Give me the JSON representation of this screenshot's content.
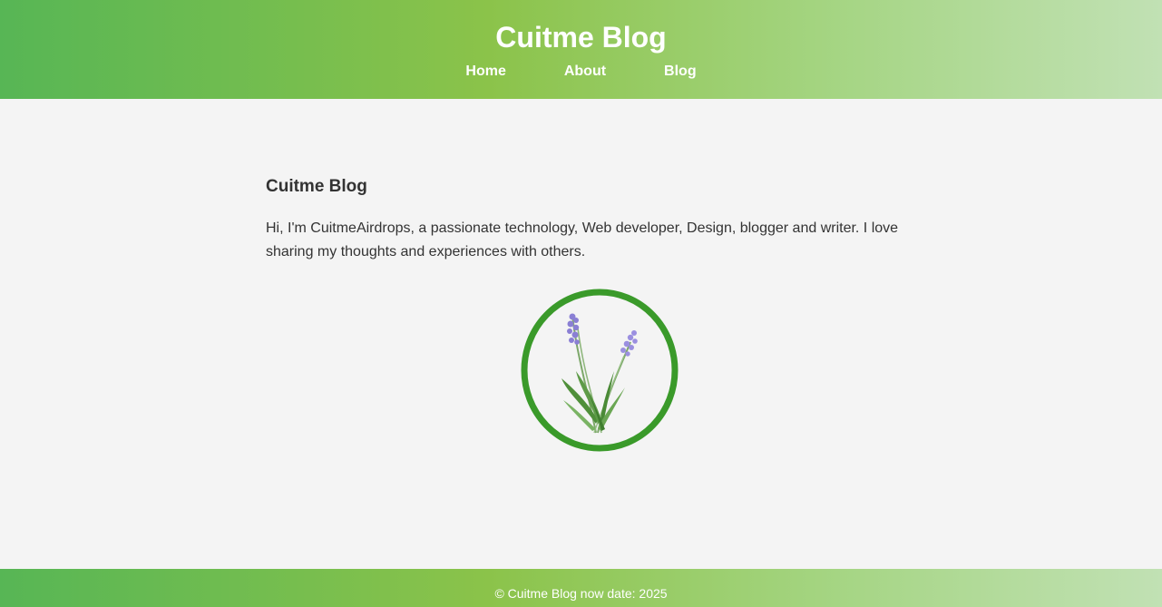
{
  "header": {
    "title": "Cuitme Blog",
    "nav": [
      {
        "label": "Home"
      },
      {
        "label": "About"
      },
      {
        "label": "Blog"
      }
    ]
  },
  "main": {
    "heading": "Cuitme Blog",
    "paragraph": "Hi, I'm CuitmeAirdrops, a passionate technology, Web developer, Design, blogger and writer. I love sharing my thoughts and experiences with others.",
    "image": {
      "icon": "lavender-emblem-icon"
    }
  },
  "footer": {
    "text": "© Cuitme Blog now date: 2025"
  },
  "colors": {
    "gradient_start": "#57b655",
    "gradient_mid": "#8bc34a",
    "gradient_end": "#c1e1b4",
    "ring": "#3a9a2a",
    "flower": "#8a7fd4",
    "page_background": "#f4f4f4",
    "text": "#333333"
  }
}
